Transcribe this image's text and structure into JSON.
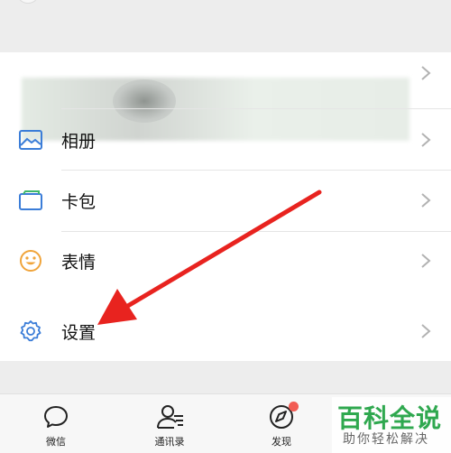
{
  "menu": {
    "items": [
      {
        "label": "相册",
        "icon": "photo-album-icon"
      },
      {
        "label": "卡包",
        "icon": "card-wallet-icon"
      },
      {
        "label": "表情",
        "icon": "sticker-emoji-icon"
      },
      {
        "label": "设置",
        "icon": "gear-icon"
      }
    ]
  },
  "tabs": [
    {
      "label": "微信",
      "icon": "chat-bubble-icon"
    },
    {
      "label": "通讯录",
      "icon": "contacts-icon"
    },
    {
      "label": "发现",
      "icon": "compass-icon",
      "badge": true
    }
  ],
  "watermark": {
    "title": "百科全说",
    "subtitle": "助你轻松解决"
  },
  "colors": {
    "accent_blue": "#3b7dd8",
    "emoji_orange": "#f0a43a",
    "badge_red": "#f25c54",
    "annotation_red": "#e8231f",
    "watermark_green": "#2fa84f"
  }
}
